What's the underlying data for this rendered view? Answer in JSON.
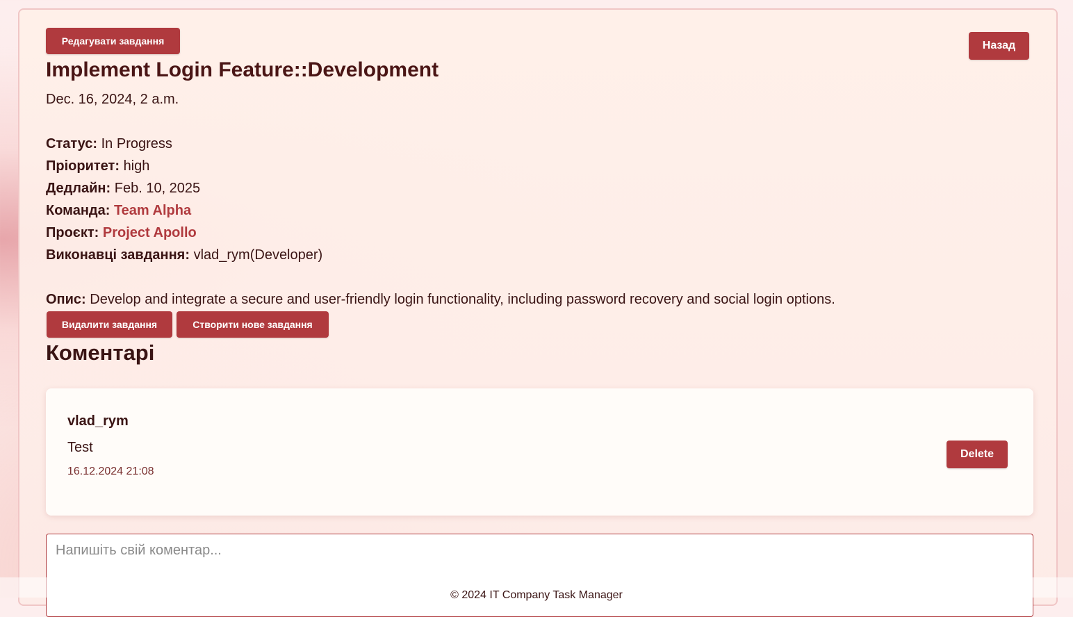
{
  "header": {
    "edit_button": "Редагувати завдання",
    "back_button": "Назад"
  },
  "task": {
    "title": "Implement Login Feature::Development",
    "created": "Dec. 16, 2024, 2 a.m.",
    "status_label": "Статус:",
    "status": "In Progress",
    "priority_label": "Пріоритет:",
    "priority": "high",
    "deadline_label": "Дедлайн:",
    "deadline": "Feb. 10, 2025",
    "team_label": "Команда:",
    "team": "Team Alpha",
    "project_label": "Проєкт:",
    "project": "Project Apollo",
    "assignees_label": "Виконавці завдання:",
    "assignees": "vlad_rym(Developer)",
    "description_label": "Опис:",
    "description": "Develop and integrate a secure and user-friendly login functionality, including password recovery and social login options."
  },
  "actions": {
    "delete_task": "Видалити завдання",
    "create_task": "Створити нове завдання"
  },
  "comments": {
    "heading": "Коментарі",
    "items": [
      {
        "author": "vlad_rym",
        "text": "Test",
        "timestamp": "16.12.2024 21:08",
        "delete_label": "Delete"
      }
    ],
    "input_placeholder": "Напишіть свій коментар..."
  },
  "footer": {
    "text": "© 2024 IT Company Task Manager"
  },
  "colors": {
    "accent": "#b03a3e",
    "text": "#3a1414"
  }
}
